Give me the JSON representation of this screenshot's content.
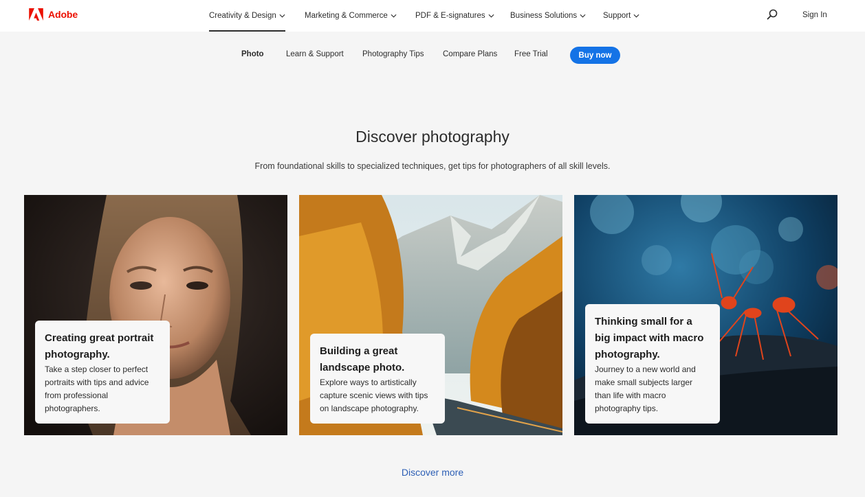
{
  "brand": {
    "name": "Adobe",
    "color": "#eb1000",
    "icon": "adobe-logo-icon"
  },
  "global_nav": {
    "items": [
      {
        "label": "Creativity & Design"
      },
      {
        "label": "Marketing & Commerce"
      },
      {
        "label": "PDF & E-signatures"
      },
      {
        "label": "Business Solutions"
      },
      {
        "label": "Support"
      }
    ],
    "search_icon": "search-icon",
    "sign_in": "Sign In"
  },
  "local_nav": {
    "items": [
      {
        "label": "Photo"
      },
      {
        "label": "Learn & Support"
      },
      {
        "label": "Photography Tips"
      },
      {
        "label": "Compare Plans"
      },
      {
        "label": "Free Trial"
      }
    ],
    "cta": "Buy now",
    "cta_color": "#1473e6"
  },
  "main": {
    "title": "Discover photography",
    "subtitle": "From foundational skills to specialized techniques, get tips for photographers of all skill levels.",
    "cards": [
      {
        "title": "Creating great portrait photography.",
        "description": "Take a step closer to perfect portraits with tips and advice from professional photographers."
      },
      {
        "title": "Building a great landscape photo.",
        "description": "Explore ways to artistically capture scenic views with tips on landscape photography."
      },
      {
        "title": "Thinking small for a big impact with macro photography.",
        "description": "Journey to a new world and make small subjects larger than life with macro photography tips."
      }
    ],
    "discover_more": "Discover more",
    "link_color": "#2d5fb5"
  }
}
